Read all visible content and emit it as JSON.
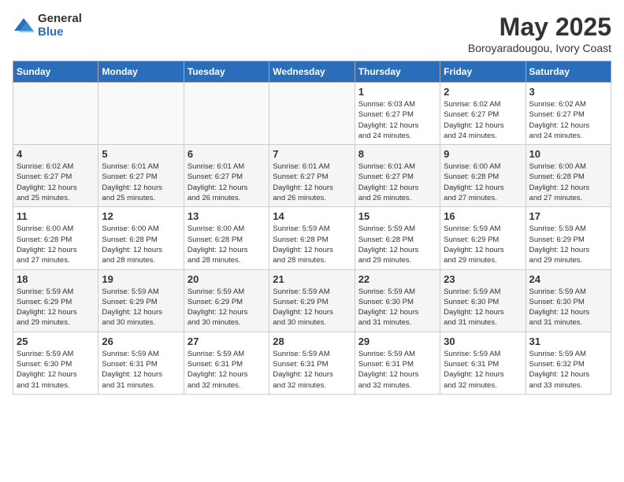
{
  "logo": {
    "general": "General",
    "blue": "Blue"
  },
  "title": "May 2025",
  "location": "Boroyaradougou, Ivory Coast",
  "days_of_week": [
    "Sunday",
    "Monday",
    "Tuesday",
    "Wednesday",
    "Thursday",
    "Friday",
    "Saturday"
  ],
  "weeks": [
    [
      {
        "day": "",
        "info": ""
      },
      {
        "day": "",
        "info": ""
      },
      {
        "day": "",
        "info": ""
      },
      {
        "day": "",
        "info": ""
      },
      {
        "day": "1",
        "info": "Sunrise: 6:03 AM\nSunset: 6:27 PM\nDaylight: 12 hours\nand 24 minutes."
      },
      {
        "day": "2",
        "info": "Sunrise: 6:02 AM\nSunset: 6:27 PM\nDaylight: 12 hours\nand 24 minutes."
      },
      {
        "day": "3",
        "info": "Sunrise: 6:02 AM\nSunset: 6:27 PM\nDaylight: 12 hours\nand 24 minutes."
      }
    ],
    [
      {
        "day": "4",
        "info": "Sunrise: 6:02 AM\nSunset: 6:27 PM\nDaylight: 12 hours\nand 25 minutes."
      },
      {
        "day": "5",
        "info": "Sunrise: 6:01 AM\nSunset: 6:27 PM\nDaylight: 12 hours\nand 25 minutes."
      },
      {
        "day": "6",
        "info": "Sunrise: 6:01 AM\nSunset: 6:27 PM\nDaylight: 12 hours\nand 26 minutes."
      },
      {
        "day": "7",
        "info": "Sunrise: 6:01 AM\nSunset: 6:27 PM\nDaylight: 12 hours\nand 26 minutes."
      },
      {
        "day": "8",
        "info": "Sunrise: 6:01 AM\nSunset: 6:27 PM\nDaylight: 12 hours\nand 26 minutes."
      },
      {
        "day": "9",
        "info": "Sunrise: 6:00 AM\nSunset: 6:28 PM\nDaylight: 12 hours\nand 27 minutes."
      },
      {
        "day": "10",
        "info": "Sunrise: 6:00 AM\nSunset: 6:28 PM\nDaylight: 12 hours\nand 27 minutes."
      }
    ],
    [
      {
        "day": "11",
        "info": "Sunrise: 6:00 AM\nSunset: 6:28 PM\nDaylight: 12 hours\nand 27 minutes."
      },
      {
        "day": "12",
        "info": "Sunrise: 6:00 AM\nSunset: 6:28 PM\nDaylight: 12 hours\nand 28 minutes."
      },
      {
        "day": "13",
        "info": "Sunrise: 6:00 AM\nSunset: 6:28 PM\nDaylight: 12 hours\nand 28 minutes."
      },
      {
        "day": "14",
        "info": "Sunrise: 5:59 AM\nSunset: 6:28 PM\nDaylight: 12 hours\nand 28 minutes."
      },
      {
        "day": "15",
        "info": "Sunrise: 5:59 AM\nSunset: 6:28 PM\nDaylight: 12 hours\nand 29 minutes."
      },
      {
        "day": "16",
        "info": "Sunrise: 5:59 AM\nSunset: 6:29 PM\nDaylight: 12 hours\nand 29 minutes."
      },
      {
        "day": "17",
        "info": "Sunrise: 5:59 AM\nSunset: 6:29 PM\nDaylight: 12 hours\nand 29 minutes."
      }
    ],
    [
      {
        "day": "18",
        "info": "Sunrise: 5:59 AM\nSunset: 6:29 PM\nDaylight: 12 hours\nand 29 minutes."
      },
      {
        "day": "19",
        "info": "Sunrise: 5:59 AM\nSunset: 6:29 PM\nDaylight: 12 hours\nand 30 minutes."
      },
      {
        "day": "20",
        "info": "Sunrise: 5:59 AM\nSunset: 6:29 PM\nDaylight: 12 hours\nand 30 minutes."
      },
      {
        "day": "21",
        "info": "Sunrise: 5:59 AM\nSunset: 6:29 PM\nDaylight: 12 hours\nand 30 minutes."
      },
      {
        "day": "22",
        "info": "Sunrise: 5:59 AM\nSunset: 6:30 PM\nDaylight: 12 hours\nand 31 minutes."
      },
      {
        "day": "23",
        "info": "Sunrise: 5:59 AM\nSunset: 6:30 PM\nDaylight: 12 hours\nand 31 minutes."
      },
      {
        "day": "24",
        "info": "Sunrise: 5:59 AM\nSunset: 6:30 PM\nDaylight: 12 hours\nand 31 minutes."
      }
    ],
    [
      {
        "day": "25",
        "info": "Sunrise: 5:59 AM\nSunset: 6:30 PM\nDaylight: 12 hours\nand 31 minutes."
      },
      {
        "day": "26",
        "info": "Sunrise: 5:59 AM\nSunset: 6:31 PM\nDaylight: 12 hours\nand 31 minutes."
      },
      {
        "day": "27",
        "info": "Sunrise: 5:59 AM\nSunset: 6:31 PM\nDaylight: 12 hours\nand 32 minutes."
      },
      {
        "day": "28",
        "info": "Sunrise: 5:59 AM\nSunset: 6:31 PM\nDaylight: 12 hours\nand 32 minutes."
      },
      {
        "day": "29",
        "info": "Sunrise: 5:59 AM\nSunset: 6:31 PM\nDaylight: 12 hours\nand 32 minutes."
      },
      {
        "day": "30",
        "info": "Sunrise: 5:59 AM\nSunset: 6:31 PM\nDaylight: 12 hours\nand 32 minutes."
      },
      {
        "day": "31",
        "info": "Sunrise: 5:59 AM\nSunset: 6:32 PM\nDaylight: 12 hours\nand 33 minutes."
      }
    ]
  ]
}
